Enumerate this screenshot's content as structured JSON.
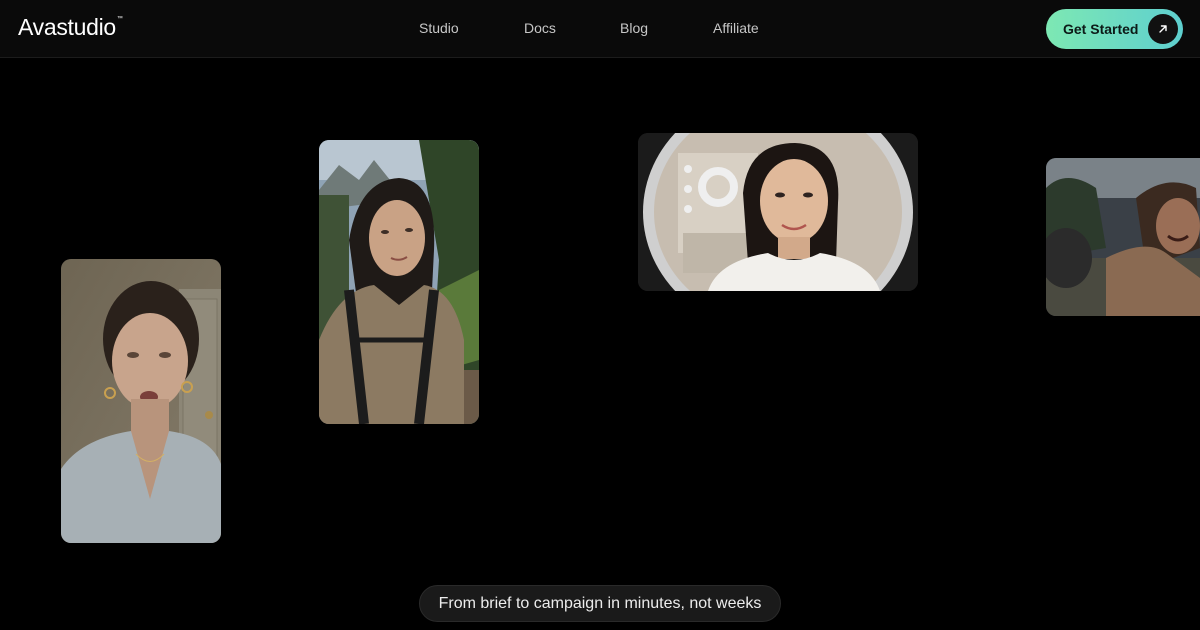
{
  "header": {
    "logo_text": "Avastudio",
    "logo_trademark": "™",
    "nav": [
      {
        "label": "Studio"
      },
      {
        "label": "Docs"
      },
      {
        "label": "Blog"
      },
      {
        "label": "Affiliate"
      }
    ],
    "cta_label": "Get Started",
    "cta_icon": "arrow-up-right-icon"
  },
  "hero": {
    "tagline": "From brief to campaign in minutes, not weeks",
    "cards": [
      {
        "name": "video-card-woman-talking",
        "subject": "woman talking to camera indoors"
      },
      {
        "name": "video-card-hiker-selfie",
        "subject": "woman hiking selfie"
      },
      {
        "name": "video-card-ring-light",
        "subject": "woman smiling in front of ring light"
      },
      {
        "name": "video-card-action-scene",
        "subject": "action scene"
      }
    ]
  },
  "colors": {
    "background": "#000000",
    "header_bg": "#0a0a0a",
    "nav_text": "#c7c7c7",
    "cta_gradient_start": "#7de8b3",
    "cta_gradient_end": "#5ecfcf",
    "tagline_bg": "#1a1a1a"
  }
}
